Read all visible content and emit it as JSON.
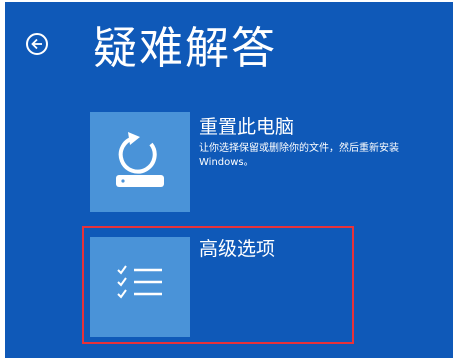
{
  "header": {
    "back_icon": "back-arrow-circle-icon",
    "title": "疑难解答"
  },
  "options": [
    {
      "icon": "reset-pc-icon",
      "title": "重置此电脑",
      "description": "让你选择保留或删除你的文件，然后重新安装 Windows。"
    },
    {
      "icon": "checklist-icon",
      "title": "高级选项",
      "description": ""
    }
  ],
  "highlight_color": "#e8323a",
  "background_color": "#0f59b8",
  "tile_color": "#4a93d8"
}
